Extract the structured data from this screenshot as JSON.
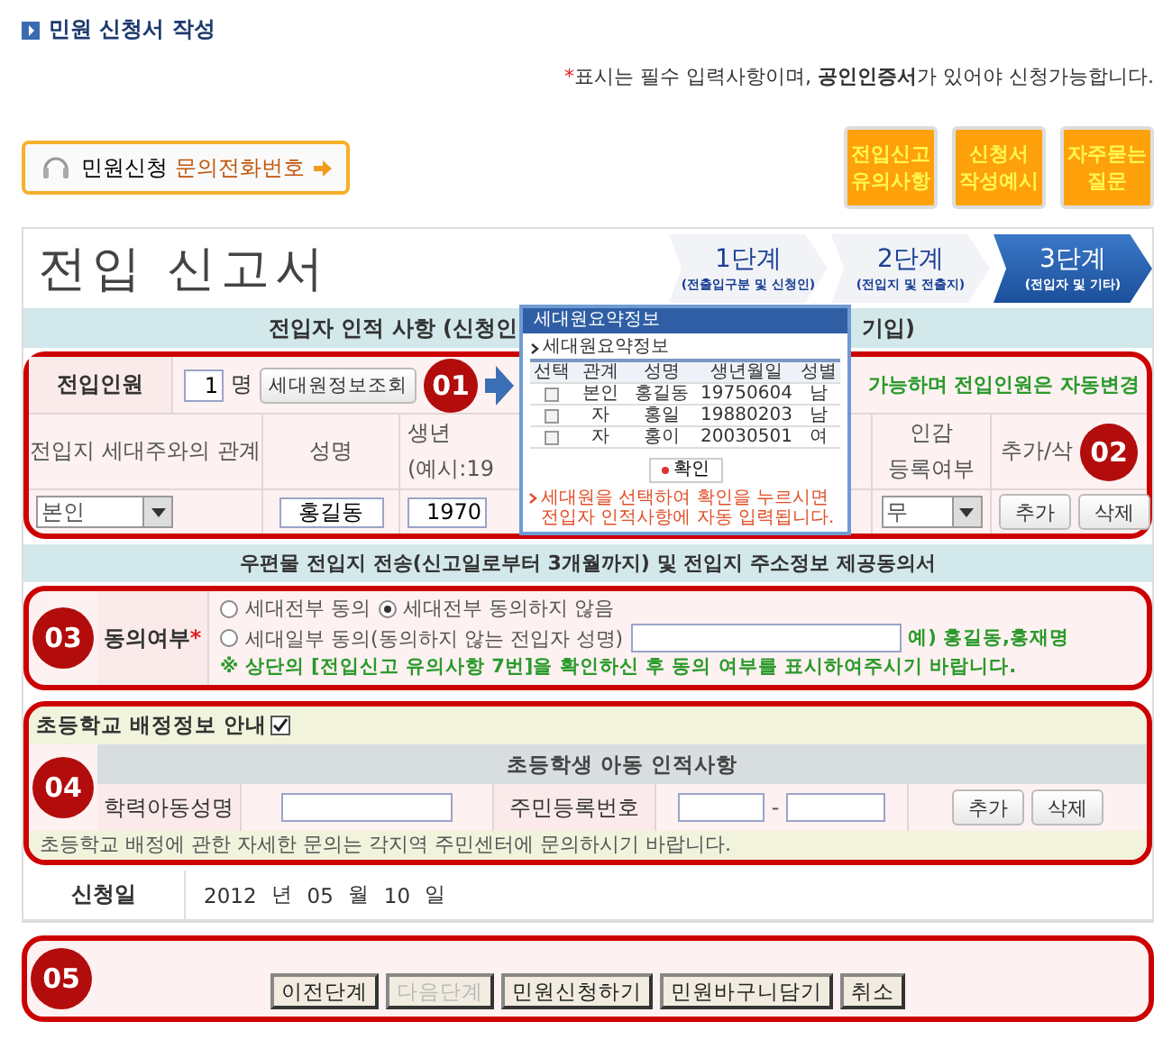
{
  "page_title": "민원 신청서 작성",
  "notice": {
    "mark": "*",
    "text": "표시는 필수 입력사항이며, **공인인증서**가 있어야 신청가능합니다."
  },
  "contact_button": {
    "label": "민원신청",
    "highlight": "문의전화번호"
  },
  "quick_buttons": [
    {
      "lines": [
        "전입신고",
        "유의사항"
      ]
    },
    {
      "lines": [
        "신청서",
        "작성예시"
      ]
    },
    {
      "lines": [
        "자주묻는",
        "질문"
      ]
    }
  ],
  "form_title": "전입 신고서",
  "steps": [
    {
      "label": "1단계",
      "caption": "(전출입구분 및 신청인)",
      "selected": false
    },
    {
      "label": "2단계",
      "caption": "(전입지 및 전출지)",
      "selected": false
    },
    {
      "label": "3단계",
      "caption": "(전입자 및 기타)",
      "selected": true
    }
  ],
  "section_1": {
    "heading_left": "전입자 인적 사항 (신청인",
    "heading_right": "기입)"
  },
  "movers": {
    "label": "전입인원",
    "count": "1",
    "unit": "명",
    "lookup_button": "세대원정보조회",
    "notice": "가능하며 전입인원은 자동변경"
  },
  "columns": [
    {
      "lines": [
        "전입지 세대주와의 관계"
      ]
    },
    {
      "lines": [
        "성명"
      ]
    },
    {
      "lines": [
        "생년",
        "(예시:19"
      ]
    },
    {
      "lines": [
        "인감",
        "등록여부"
      ]
    },
    {
      "lines": [
        "추가/삭"
      ]
    }
  ],
  "row": {
    "relation": "본인",
    "name": "홍길동",
    "birth": "1970",
    "seal": "무",
    "add": "추가",
    "delete": "삭제"
  },
  "popup": {
    "title": "세대원요약정보",
    "subtitle": "세대원요약정보",
    "columns": [
      "선택",
      "관계",
      "성명",
      "생년월일",
      "성별"
    ],
    "rows": [
      {
        "checked": false,
        "relation": "본인",
        "name": "홍길동",
        "birth": "19750604",
        "sex": "남"
      },
      {
        "checked": false,
        "relation": "자",
        "name": "홍일",
        "birth": "19880203",
        "sex": "남"
      },
      {
        "checked": false,
        "relation": "자",
        "name": "홍이",
        "birth": "20030501",
        "sex": "여"
      }
    ],
    "confirm": "확인",
    "note": "세대원을 선택하여 확인을 누르시면 전입자 인적사항에 자동 입력됩니다."
  },
  "section_2": {
    "heading": "우편물 전입지 전송(신고일로부터 3개월까지) 및 전입지 주소정보 제공동의서"
  },
  "consent": {
    "label": "동의여부",
    "required_mark": "*",
    "options": [
      {
        "label": "세대전부 동의",
        "selected": false
      },
      {
        "label": "세대전부 동의하지 않음",
        "selected": true
      },
      {
        "label": "세대일부 동의(동의하지 않는 전입자 성명)",
        "selected": false
      }
    ],
    "example": "예) 홍길동,홍재명",
    "note": "※ 상단의 [전입신고 유의사항 7번]을 확인하신 후 동의 여부를 표시하여주시기 바랍니다."
  },
  "school": {
    "title": "초등학교 배정정보 안내",
    "checked": true,
    "subheading": "초등학생 아동 인적사항",
    "name_label": "학력아동성명",
    "id_label": "주민등록번호",
    "id_separator": "-",
    "add": "추가",
    "delete": "삭제",
    "note": "초등학교 배정에 관한 자세한 문의는 각지역 주민센터에 문의하시기 바랍니다."
  },
  "date": {
    "label": "신청일",
    "year": "2012",
    "year_unit": "년",
    "month": "05",
    "month_unit": "월",
    "day": "10",
    "day_unit": "일"
  },
  "actions": [
    {
      "label": "이전단계",
      "disabled": false
    },
    {
      "label": "다음단계",
      "disabled": true
    },
    {
      "label": "민원신청하기",
      "disabled": false
    },
    {
      "label": "민원바구니담기",
      "disabled": false
    },
    {
      "label": "취소",
      "disabled": false
    }
  ],
  "markers": [
    "01",
    "02",
    "03",
    "04",
    "05"
  ]
}
